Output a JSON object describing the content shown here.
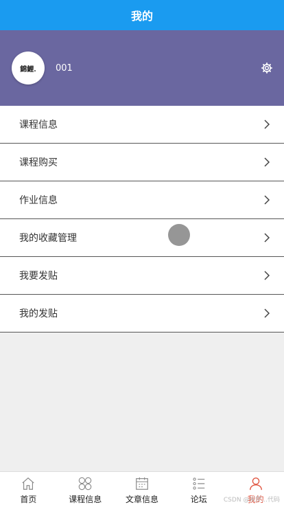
{
  "header": {
    "title": "我的"
  },
  "profile": {
    "avatar_text": "錦鯉.",
    "username": "001",
    "settings_icon": "gear-icon"
  },
  "menu": [
    {
      "label": "课程信息"
    },
    {
      "label": "课程购买"
    },
    {
      "label": "作业信息"
    },
    {
      "label": "我的收藏管理"
    },
    {
      "label": "我要发贴"
    },
    {
      "label": "我的发贴"
    }
  ],
  "tabbar": [
    {
      "label": "首页",
      "icon": "home-icon"
    },
    {
      "label": "课程信息",
      "icon": "clover-icon"
    },
    {
      "label": "文章信息",
      "icon": "calendar-icon"
    },
    {
      "label": "论坛",
      "icon": "list-icon"
    },
    {
      "label": "我的",
      "icon": "user-icon",
      "active": true
    }
  ],
  "colors": {
    "topbar": "#1a9bf0",
    "profile_bg": "#6a67a0",
    "active_tab": "#e0523d"
  },
  "watermark": "CSDN @米罗...代码"
}
